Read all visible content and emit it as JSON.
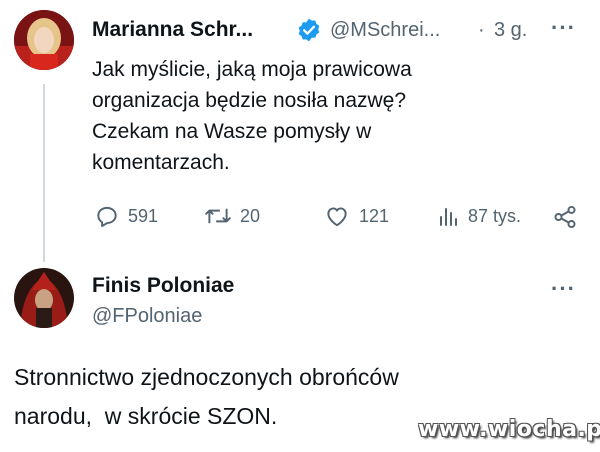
{
  "tweet": {
    "author_name": "Marianna Schr...",
    "author_handle": "@MSchrei...",
    "separator": "·",
    "time": "3 g.",
    "more": "···",
    "text_lines": [
      "Jak myślicie, jaką moja prawicowa",
      "organizacja będzie nosiła nazwę?",
      "Czekam na Wasze pomysły w",
      "komentarzach."
    ],
    "actions": {
      "replies": "591",
      "retweets": "20",
      "likes": "121",
      "views": "87 tys."
    },
    "verified_color": "#1d9bf0"
  },
  "reply": {
    "author_name": "Finis Poloniae",
    "author_handle": "@FPoloniae",
    "more": "···",
    "text_lines": [
      "Stronnictwo zjednoczonych obrońców",
      "narodu,  w skrócie SZON."
    ]
  },
  "watermark": {
    "text": "www.wiocha.pl"
  },
  "colors": {
    "text": "#0f1419",
    "muted": "#536471",
    "thread_line": "#cfd9de"
  }
}
